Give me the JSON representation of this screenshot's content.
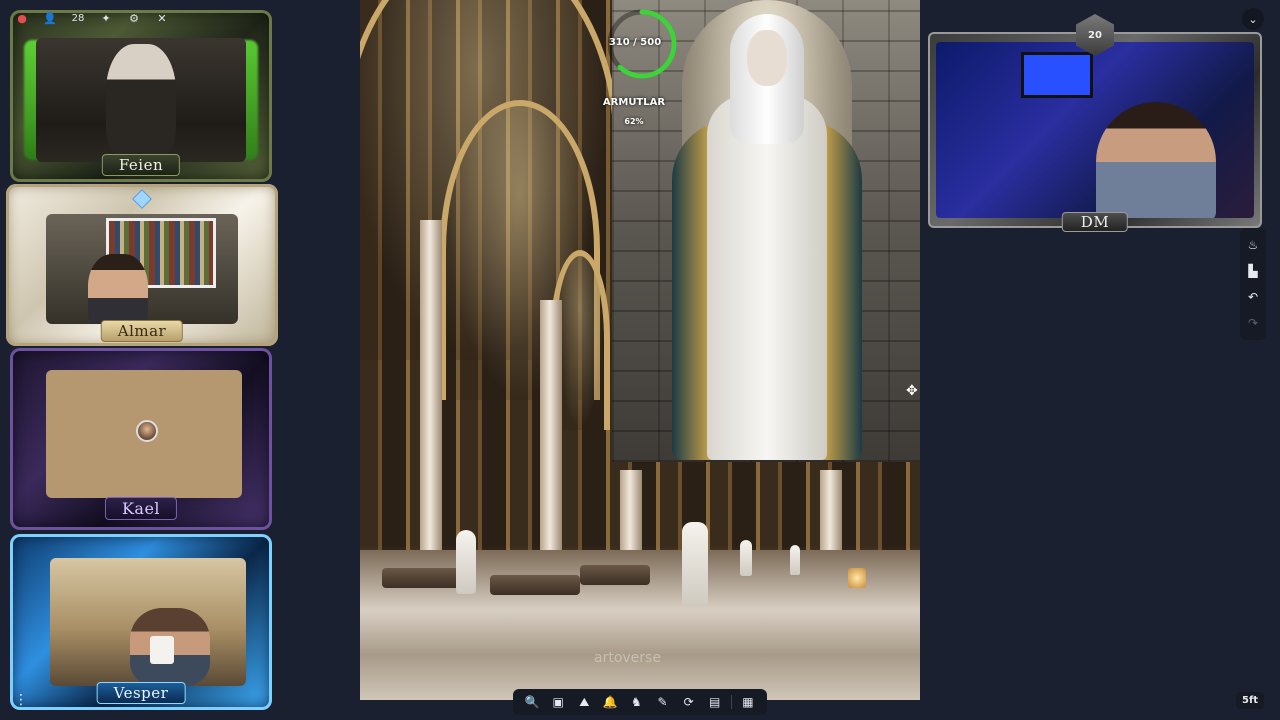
{
  "mini_toolbar": {
    "icons": [
      "record-dot-icon",
      "user-icon",
      "players-icon",
      "grid-icon",
      "settings-icon",
      "close-icon"
    ],
    "players_count": "28"
  },
  "players": [
    {
      "name": "Feien",
      "frame_color": "#4d5a35"
    },
    {
      "name": "Almar",
      "frame_color": "#cfc6b0"
    },
    {
      "name": "Kael",
      "frame_color": "#3b2a5c"
    },
    {
      "name": "Vesper",
      "frame_color": "#2f8fe0"
    }
  ],
  "token": {
    "hp_text": "310 / 500",
    "hp_current": 310,
    "hp_max": 500,
    "name": "ARMUTLAR",
    "percent": "62%",
    "ring_color": "#3fd23a"
  },
  "map": {
    "watermark": "artoverse"
  },
  "dm": {
    "label": "DM",
    "die": "20"
  },
  "bottom_toolbar": [
    {
      "id": "search",
      "icon": "🔍"
    },
    {
      "id": "image",
      "icon": "▣"
    },
    {
      "id": "terrain",
      "icon": "⛰"
    },
    {
      "id": "bell",
      "icon": "🔔"
    },
    {
      "id": "creature",
      "icon": "♞"
    },
    {
      "id": "draw",
      "icon": "✎"
    },
    {
      "id": "refresh",
      "icon": "⟳"
    },
    {
      "id": "notes",
      "icon": "▤"
    },
    {
      "id": "apps",
      "icon": "▦"
    }
  ],
  "right_toolbar": [
    {
      "id": "fire",
      "icon": "♨"
    },
    {
      "id": "chart",
      "icon": "▙"
    },
    {
      "id": "undo",
      "icon": "↶"
    },
    {
      "id": "redo",
      "icon": "↷"
    }
  ],
  "chevron": "⌄",
  "more": "⋮",
  "grid_scale": "5ft"
}
